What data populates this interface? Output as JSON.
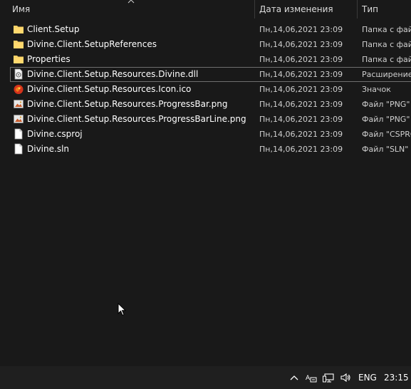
{
  "columns": {
    "name": "Имя",
    "date": "Дата изменения",
    "type": "Тип"
  },
  "files": [
    {
      "name": "Client.Setup",
      "date": "Пн,14,06,2021 23:09",
      "type": "Папка с фай",
      "icon": "folder-icon"
    },
    {
      "name": "Divine.Client.SetupReferences",
      "date": "Пн,14,06,2021 23:09",
      "type": "Папка с фай",
      "icon": "folder-icon"
    },
    {
      "name": "Properties",
      "date": "Пн,14,06,2021 23:09",
      "type": "Папка с фай",
      "icon": "folder-icon"
    },
    {
      "name": "Divine.Client.Setup.Resources.Divine.dll",
      "date": "Пн,14,06,2021 23:09",
      "type": "Расширение",
      "icon": "dll-file-icon"
    },
    {
      "name": "Divine.Client.Setup.Resources.Icon.ico",
      "date": "Пн,14,06,2021 23:09",
      "type": "Значок",
      "icon": "ico-file-icon"
    },
    {
      "name": "Divine.Client.Setup.Resources.ProgressBar.png",
      "date": "Пн,14,06,2021 23:09",
      "type": "Файл \"PNG\"",
      "icon": "png-file-icon"
    },
    {
      "name": "Divine.Client.Setup.Resources.ProgressBarLine.png",
      "date": "Пн,14,06,2021 23:09",
      "type": "Файл \"PNG\"",
      "icon": "png-file-icon"
    },
    {
      "name": "Divine.csproj",
      "date": "Пн,14,06,2021 23:09",
      "type": "Файл \"CSPRO",
      "icon": "document-icon"
    },
    {
      "name": "Divine.sln",
      "date": "Пн,14,06,2021 23:09",
      "type": "Файл \"SLN\"",
      "icon": "document-icon"
    }
  ],
  "taskbar": {
    "language": "ENG",
    "time": "23:15"
  },
  "colors": {
    "background": "#191919",
    "taskbar": "#1f1f1f",
    "folder": "#f8d167",
    "focus_border": "#6f6f6f"
  }
}
